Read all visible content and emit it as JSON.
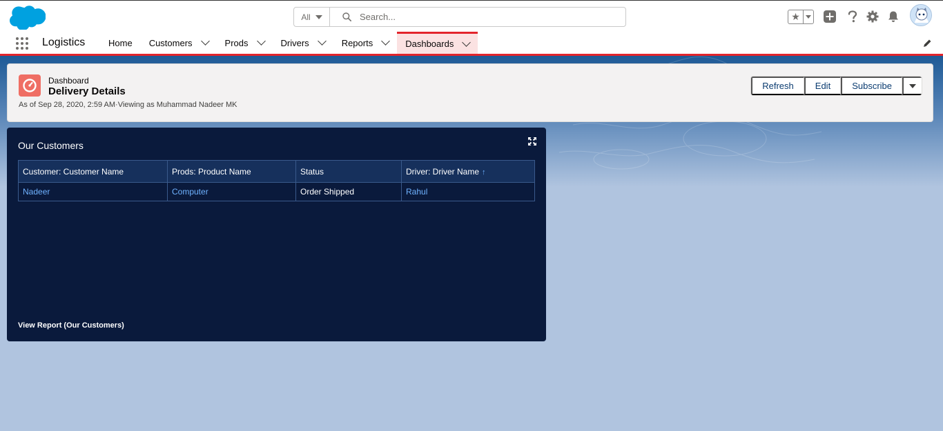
{
  "header": {
    "search": {
      "scope": "All",
      "placeholder": "Search..."
    },
    "user": {
      "avatar": "user-avatar"
    }
  },
  "nav": {
    "app_name": "Logistics",
    "items": [
      {
        "label": "Home",
        "has_menu": false,
        "active": false
      },
      {
        "label": "Customers",
        "has_menu": true,
        "active": false
      },
      {
        "label": "Prods",
        "has_menu": true,
        "active": false
      },
      {
        "label": "Drivers",
        "has_menu": true,
        "active": false
      },
      {
        "label": "Reports",
        "has_menu": true,
        "active": false
      },
      {
        "label": "Dashboards",
        "has_menu": true,
        "active": true
      }
    ]
  },
  "dashboard": {
    "type_label": "Dashboard",
    "title": "Delivery Details",
    "meta": "As of Sep 28, 2020, 2:59 AM·Viewing as Muhammad Nadeer MK",
    "buttons": {
      "refresh": "Refresh",
      "edit": "Edit",
      "subscribe": "Subscribe"
    }
  },
  "widget": {
    "title": "Our Customers",
    "columns": [
      "Customer: Customer Name",
      "Prods: Product Name",
      "Status",
      "Driver: Driver Name"
    ],
    "sort_indicator": "↑",
    "rows": [
      [
        "Nadeer",
        "Computer",
        "Order Shipped",
        "Rahul"
      ]
    ],
    "view_report": "View Report (Our Customers)"
  },
  "colors": {
    "brand": "#00a1e0",
    "accent_red": "#e3242b",
    "widget_bg": "#0a1a3c",
    "link": "#6fb2ff"
  }
}
